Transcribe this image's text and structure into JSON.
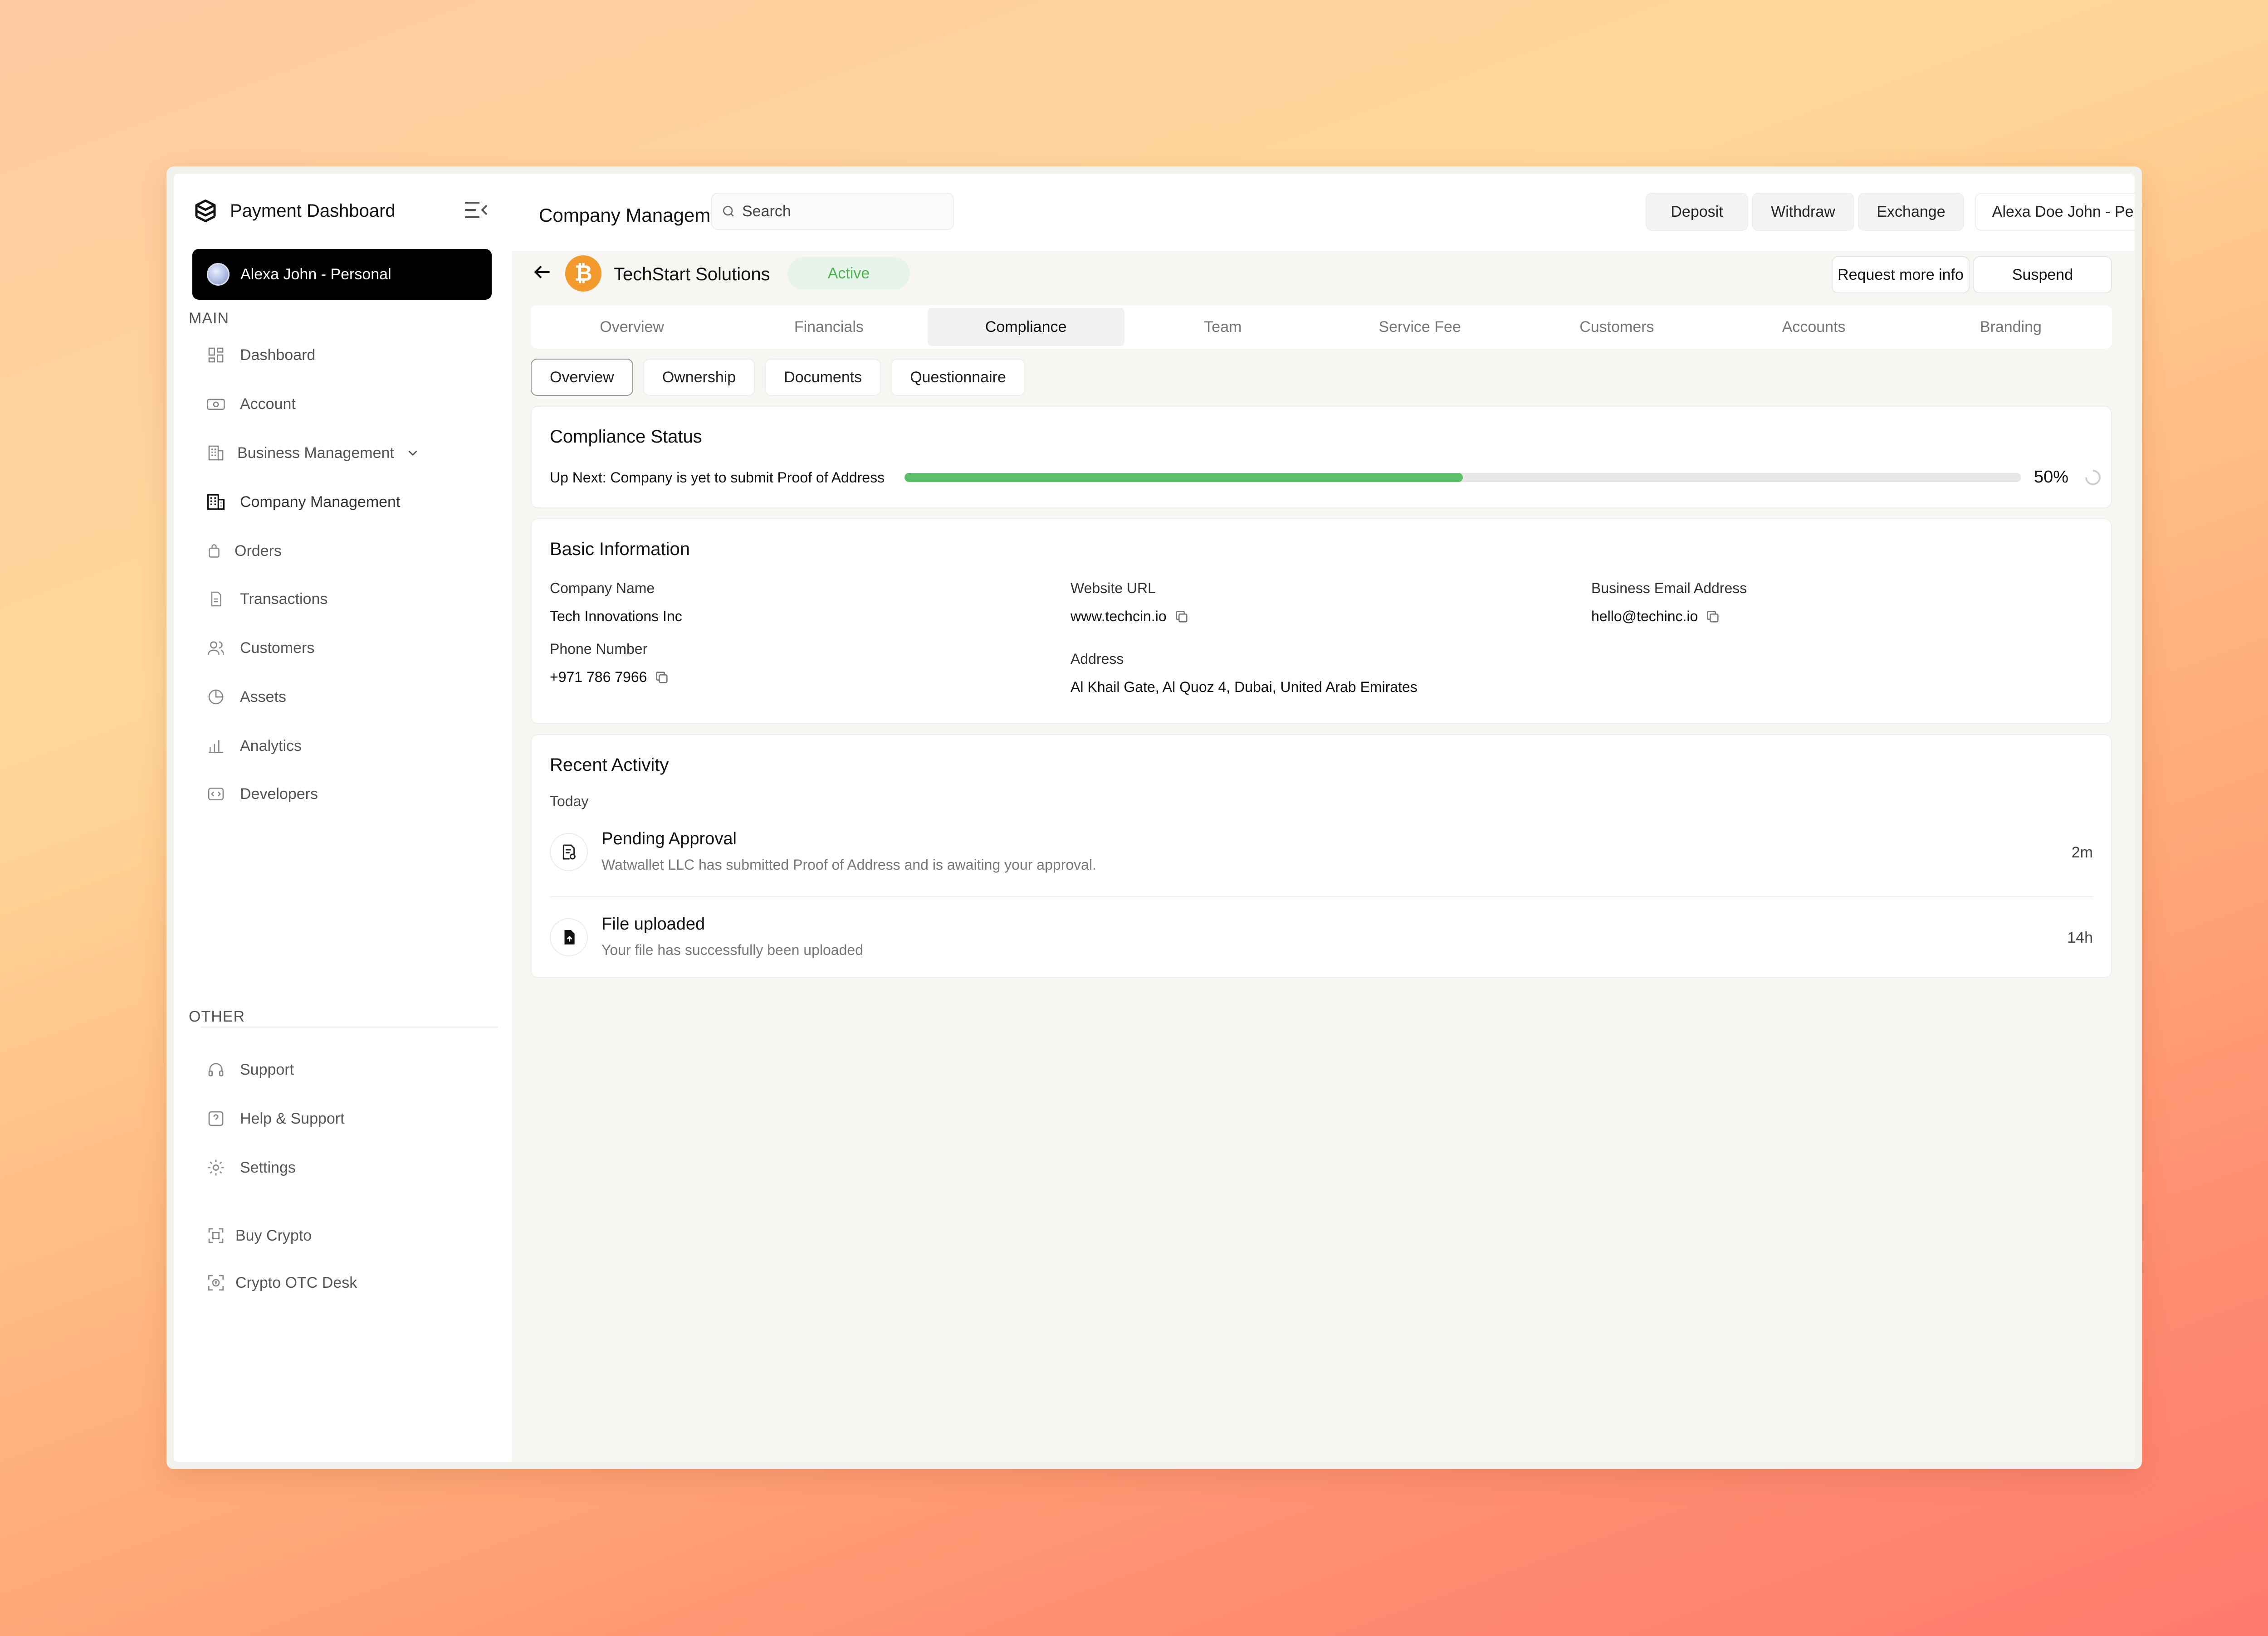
{
  "app": {
    "title": "Payment Dashboard"
  },
  "sidebar": {
    "account": "Alexa John - Personal",
    "main_label": "MAIN",
    "other_label": "OTHER",
    "items": [
      {
        "label": "Dashboard",
        "icon": "dashboard-icon"
      },
      {
        "label": "Account",
        "icon": "account-icon"
      },
      {
        "label": "Business Management",
        "icon": "building-icon"
      },
      {
        "label": "Company Management",
        "icon": "company-icon"
      },
      {
        "label": "Orders",
        "icon": "bag-icon"
      },
      {
        "label": "Transactions",
        "icon": "file-icon"
      },
      {
        "label": "Customers",
        "icon": "users-icon"
      },
      {
        "label": "Assets",
        "icon": "pie-icon"
      },
      {
        "label": "Analytics",
        "icon": "bar-chart-icon"
      },
      {
        "label": "Developers",
        "icon": "code-icon"
      }
    ],
    "other_items": [
      {
        "label": "Support",
        "icon": "headset-icon"
      },
      {
        "label": "Help & Support",
        "icon": "help-icon"
      },
      {
        "label": "Settings",
        "icon": "gear-icon"
      }
    ],
    "extra_items": [
      {
        "label": "Buy Crypto",
        "icon": "scan-icon"
      },
      {
        "label": "Crypto OTC Desk",
        "icon": "otc-icon"
      }
    ]
  },
  "topbar": {
    "title": "Company Management",
    "search_placeholder": "Search",
    "deposit": "Deposit",
    "withdraw": "Withdraw",
    "exchange": "Exchange",
    "account_select": "Alexa Doe John - Personal"
  },
  "company": {
    "name": "TechStart Solutions",
    "status": "Active",
    "request_info": "Request more info",
    "suspend": "Suspend"
  },
  "tabs": [
    "Overview",
    "Financials",
    "Compliance",
    "Team",
    "Service Fee",
    "Customers",
    "Accounts",
    "Branding"
  ],
  "subtabs": [
    "Overview",
    "Ownership",
    "Documents",
    "Questionnaire"
  ],
  "compliance": {
    "title": "Compliance Status",
    "next_step": "Up Next: Company is yet to submit Proof of Address",
    "progress": 0.5,
    "progress_text": "50%"
  },
  "basic_info": {
    "title": "Basic Information",
    "company_name_label": "Company Name",
    "company_name": "Tech Innovations Inc",
    "website_label": "Website URL",
    "website": "www.techcin.io",
    "email_label": "Business Email Address",
    "email": "hello@techinc.io",
    "phone_label": "Phone Number",
    "phone": "+971 786 7966",
    "address_label": "Address",
    "address": "Al Khail Gate, Al Quoz 4, Dubai, United Arab Emirates"
  },
  "activity": {
    "title": "Recent Activity",
    "group": "Today",
    "items": [
      {
        "title": "Pending Approval",
        "description": "Watwallet LLC has submitted Proof of Address and is awaiting your approval.",
        "time": "2m"
      },
      {
        "title": "File uploaded",
        "description": "Your file has successfully been uploaded",
        "time": "14h"
      }
    ]
  },
  "colors": {
    "accent_green": "#5cc06a",
    "bitcoin_orange": "#f39a2c",
    "active_badge": "#4caf50"
  }
}
